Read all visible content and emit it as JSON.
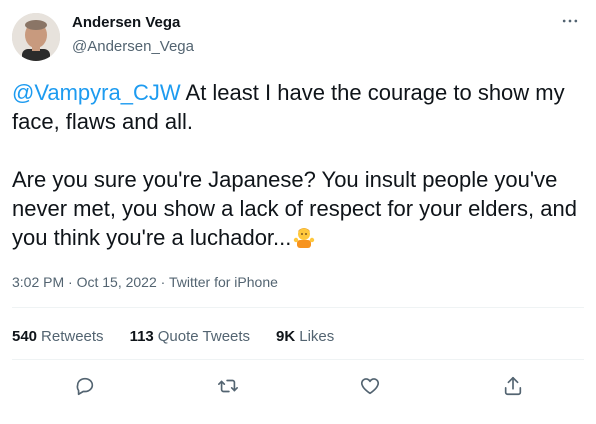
{
  "author": {
    "name": "Andersen Vega",
    "handle": "@Andersen_Vega"
  },
  "tweet": {
    "mention": "@Vampyra_CJW",
    "text_part1": " At least I have the courage to show my face, flaws and all.\n\nAre you sure you're Japanese? You insult people you've never met, you show a lack of respect for your elders, and you think you're a luchador...",
    "emoji_name": "person-gesturing-ok-emoji",
    "timestamp": "3:02 PM · Oct 15, 2022",
    "separator": " · ",
    "source": "Twitter for iPhone"
  },
  "stats": {
    "retweets_count": "540",
    "retweets_label": "Retweets",
    "quotes_count": "113",
    "quotes_label": "Quote Tweets",
    "likes_count": "9K",
    "likes_label": "Likes"
  },
  "icons": {
    "more": "more-icon",
    "reply": "reply-icon",
    "retweet": "retweet-icon",
    "like": "heart-icon",
    "share": "share-icon"
  },
  "colors": {
    "accent": "#1d9bf0",
    "text": "#0f1419",
    "secondary": "#536471",
    "divider": "#eff3f4"
  }
}
